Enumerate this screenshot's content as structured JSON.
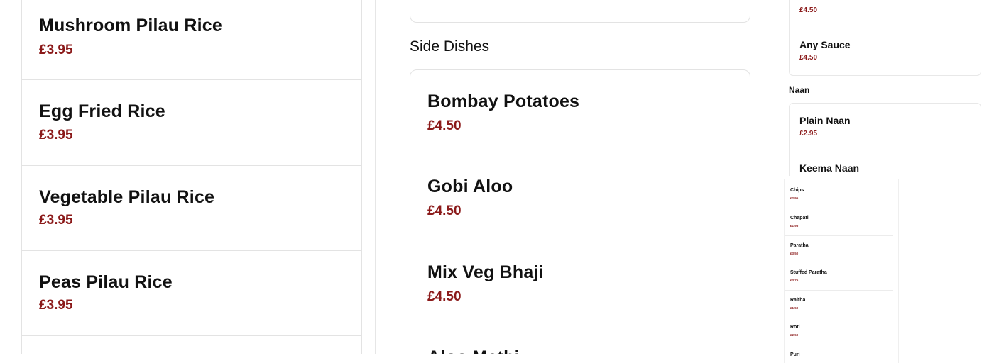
{
  "left_column": {
    "items": [
      {
        "name": "Mushroom Pilau Rice",
        "price": "£3.95"
      },
      {
        "name": "Egg Fried Rice",
        "price": "£3.95"
      },
      {
        "name": "Vegetable Pilau Rice",
        "price": "£3.95"
      },
      {
        "name": "Peas Pilau Rice",
        "price": "£3.95"
      }
    ]
  },
  "middle_column": {
    "section_title": "Side Dishes",
    "items": [
      {
        "name": "Bombay Potatoes",
        "price": "£4.50"
      },
      {
        "name": "Gobi Aloo",
        "price": "£4.50"
      },
      {
        "name": "Mix Veg Bhaji",
        "price": "£4.50"
      },
      {
        "name": "Aloo Methi",
        "price": ""
      }
    ]
  },
  "right_column": {
    "top_partial_price": "£4.50",
    "sauce_item": {
      "name": "Any Sauce",
      "price": "£4.50"
    },
    "naan_section_title": "Naan",
    "naan_items": [
      {
        "name": "Plain Naan",
        "price": "£2.95"
      },
      {
        "name": "Keema Naan",
        "price": ""
      }
    ]
  },
  "popup_list": {
    "items": [
      {
        "name": "Chips",
        "price": "£2.95"
      },
      {
        "name": "Chapati",
        "price": "£1.95"
      },
      {
        "name": "Paratha",
        "price": "£3.50"
      },
      {
        "name": "Stuffed Paratha",
        "price": "£3.75"
      },
      {
        "name": "Raitha",
        "price": "£1.50"
      },
      {
        "name": "Roti",
        "price": "£2.50"
      },
      {
        "name": "Puri",
        "price": ""
      }
    ]
  },
  "colors": {
    "price": "#8b1a1a",
    "border": "#e3e3e3",
    "background": "#ffffff"
  }
}
